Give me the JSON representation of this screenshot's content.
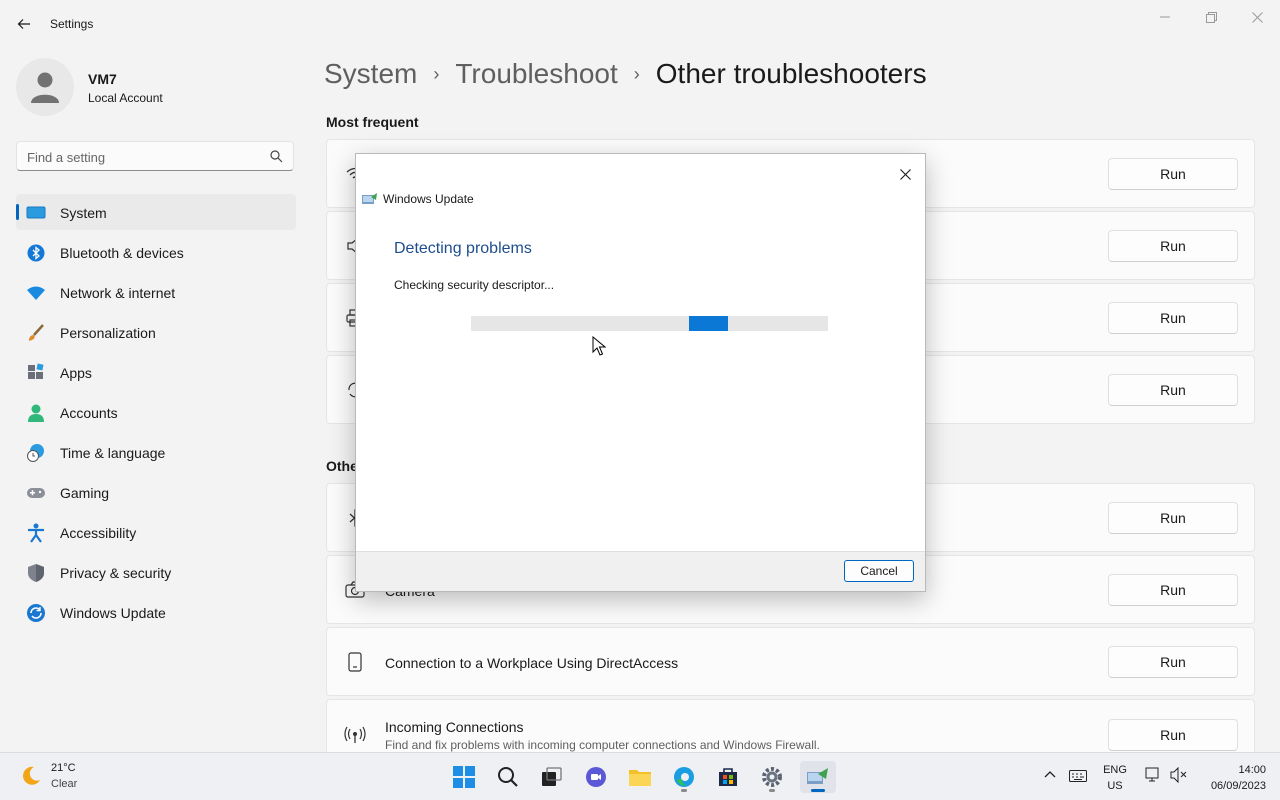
{
  "app": {
    "title": "Settings"
  },
  "profile": {
    "name": "VM7",
    "account_type": "Local Account"
  },
  "search": {
    "placeholder": "Find a setting"
  },
  "sidebar": {
    "items": [
      {
        "label": "System",
        "icon": "system-icon",
        "active": true
      },
      {
        "label": "Bluetooth & devices",
        "icon": "bluetooth-icon"
      },
      {
        "label": "Network & internet",
        "icon": "wifi-icon"
      },
      {
        "label": "Personalization",
        "icon": "brush-icon"
      },
      {
        "label": "Apps",
        "icon": "apps-icon"
      },
      {
        "label": "Accounts",
        "icon": "accounts-icon"
      },
      {
        "label": "Time & language",
        "icon": "clock-globe-icon"
      },
      {
        "label": "Gaming",
        "icon": "gamepad-icon"
      },
      {
        "label": "Accessibility",
        "icon": "accessibility-icon"
      },
      {
        "label": "Privacy & security",
        "icon": "shield-icon"
      },
      {
        "label": "Windows Update",
        "icon": "update-icon"
      }
    ]
  },
  "breadcrumb": {
    "items": [
      "System",
      "Troubleshoot",
      "Other troubleshooters"
    ]
  },
  "sections": {
    "most_frequent": "Most frequent",
    "other": "Other"
  },
  "troubleshooters": {
    "run_label": "Run",
    "visible": [
      {
        "title": "Camera",
        "icon": "camera-icon"
      },
      {
        "title": "Connection to a Workplace Using DirectAccess",
        "icon": "phone-device-icon"
      },
      {
        "title": "Incoming Connections",
        "description": "Find and fix problems with incoming computer connections and Windows Firewall.",
        "icon": "incoming-icon"
      }
    ]
  },
  "dialog": {
    "app_title": "Windows Update",
    "heading": "Detecting problems",
    "status": "Checking security descriptor...",
    "cancel_label": "Cancel",
    "progress_position": 0.61
  },
  "taskbar": {
    "weather": {
      "temp": "21°C",
      "condition": "Clear"
    },
    "apps": [
      "start-icon",
      "search-icon",
      "task-view-icon",
      "meet-icon",
      "file-explorer-icon",
      "edge-icon",
      "store-icon",
      "settings-icon",
      "troubleshooter-icon"
    ],
    "language": {
      "line1": "ENG",
      "line2": "US"
    },
    "time": "14:00",
    "date": "06/09/2023"
  },
  "colors": {
    "accent": "#0067c0",
    "progress": "#0a78d4",
    "dialog_heading": "#1e4e8c"
  }
}
